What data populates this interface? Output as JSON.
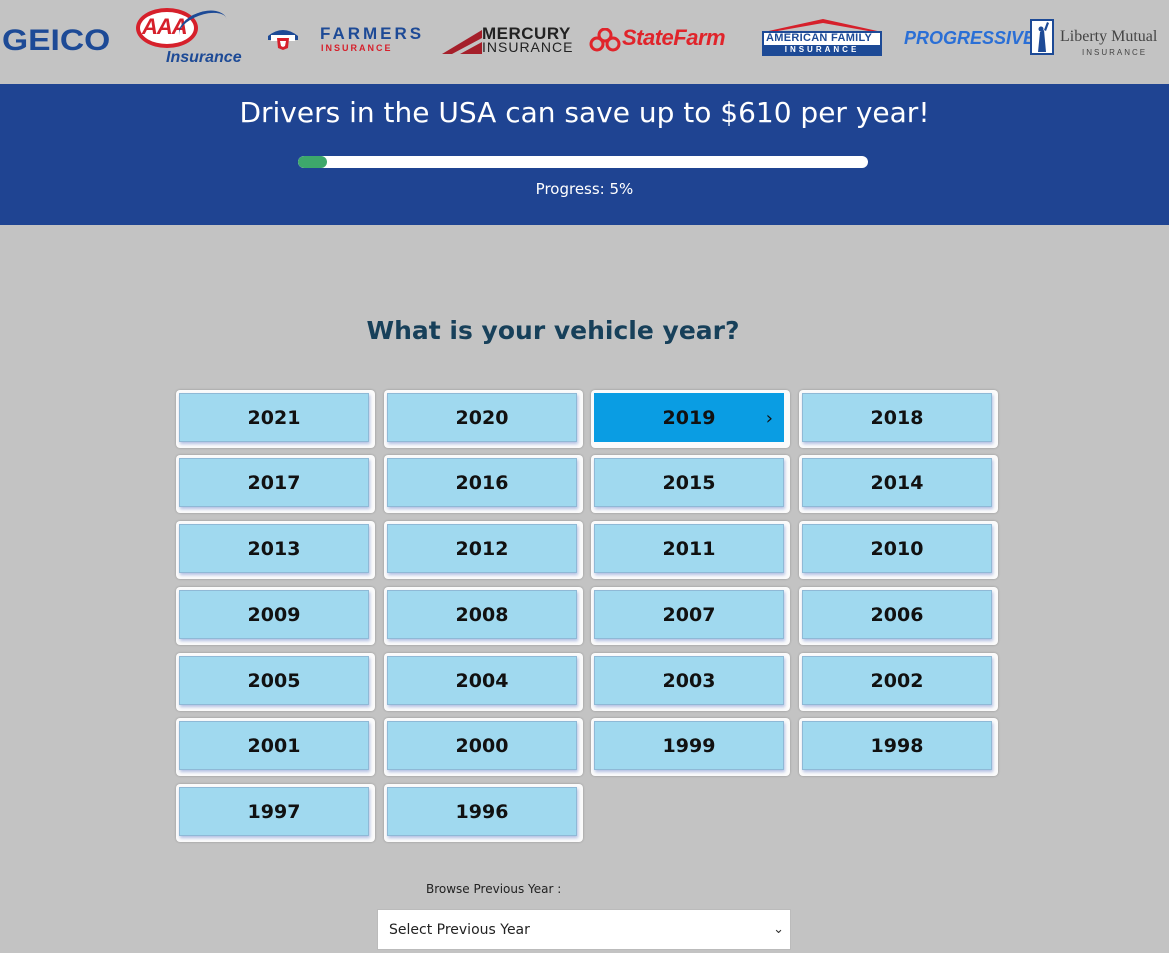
{
  "logos": {
    "geico": "GEICO",
    "aaa_mark": "AAA",
    "aaa_sub": "Insurance",
    "farmers_word": "FARMERS",
    "farmers_sub": "INSURANCE",
    "mercury_word": "MERCURY",
    "mercury_sub": "INSURANCE",
    "statefarm": "StateFarm",
    "amfam_word": "AMERICAN FAMILY",
    "amfam_sub": "INSURANCE",
    "progressive": "PROGRESSIVE",
    "liberty_word": "Liberty Mutual",
    "liberty_sub": "INSURANCE"
  },
  "banner": {
    "headline": "Drivers in the USA can save up to $610 per year!",
    "progress_label": "Progress: 5%",
    "progress_percent": 5
  },
  "question": "What is your vehicle year?",
  "years": [
    "2021",
    "2020",
    "2019",
    "2018",
    "2017",
    "2016",
    "2015",
    "2014",
    "2013",
    "2012",
    "2011",
    "2010",
    "2009",
    "2008",
    "2007",
    "2006",
    "2005",
    "2004",
    "2003",
    "2002",
    "2001",
    "2000",
    "1999",
    "1998",
    "1997",
    "1996"
  ],
  "selected_year": "2019",
  "selected_arrow": "›",
  "browse": {
    "label": "Browse Previous Year :",
    "select_value": "Select Previous Year",
    "chevron": "⌄"
  },
  "colors": {
    "banner": "#1f4492",
    "progress_fill": "#3da86b",
    "button": "#a0d9ef",
    "button_selected": "#0a9de3"
  }
}
